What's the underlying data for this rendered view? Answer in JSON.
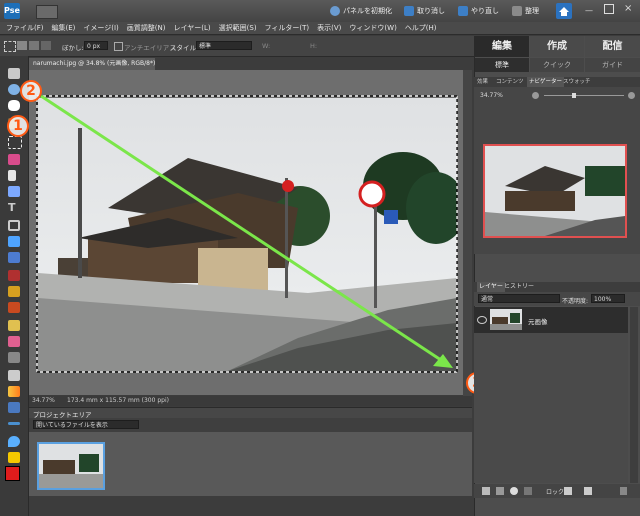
{
  "topbar": {
    "reset_panels": "パネルを初期化",
    "undo": "取り消し",
    "redo": "やり直し",
    "organize": "整理"
  },
  "menubar": [
    "ファイル(F)",
    "編集(E)",
    "イメージ(I)",
    "画質調整(N)",
    "レイヤー(L)",
    "選択範囲(S)",
    "フィルター(T)",
    "表示(V)",
    "ウィンドウ(W)",
    "ヘルプ(H)"
  ],
  "options": {
    "feather_label": "ぼかし:",
    "feather_value": "0 px",
    "antialias_label": "アンチエイリアス",
    "style_label": "スタイル:",
    "style_value": "標準",
    "width_label": "W:",
    "height_label": "H:"
  },
  "document": {
    "tab_title": "narumachi.jpg @ 34.8% (元画像, RGB/8*) ×",
    "zoom": "34.77%",
    "doc_info": "173.4 mm x 115.57 mm (300 ppi)"
  },
  "project": {
    "title": "プロジェクトエリア",
    "show_dropdown": "開いているファイルを表示"
  },
  "modes": {
    "edit": "編集",
    "create": "作成",
    "share": "配信"
  },
  "submodes": {
    "standard": "標準",
    "quick": "クイック",
    "guided": "ガイド"
  },
  "panel_tabs": [
    "効果",
    "コンテンツ",
    "ナビゲーター",
    "スウォッチ"
  ],
  "navigator": {
    "zoom": "34.77%"
  },
  "layers": {
    "tabs": [
      "レイヤー",
      "ヒストリー"
    ],
    "blend_mode": "通常",
    "opacity_label": "不透明度:",
    "opacity_value": "100%",
    "layer_name": "元画像",
    "lock_label": "ロック:"
  },
  "annotations": {
    "one": "1",
    "two": "2",
    "three": "3"
  },
  "colors": {
    "accent_orange": "#ff5a14",
    "arrow_green": "#7be64a",
    "foreground_color": "#e01c1c",
    "background_color": "#ffffff"
  },
  "icons": [
    "app-logo-icon",
    "mode-icon",
    "undo-icon",
    "redo-icon",
    "organize-icon",
    "home-icon",
    "move-tool-icon",
    "zoom-tool-icon",
    "hand-tool-icon",
    "marquee-tool-icon",
    "lasso-tool-icon",
    "magic-wand-icon",
    "text-tool-icon",
    "crop-tool-icon",
    "brush-tool-icon",
    "eraser-tool-icon",
    "eye-icon",
    "lock-icon",
    "trash-icon"
  ]
}
